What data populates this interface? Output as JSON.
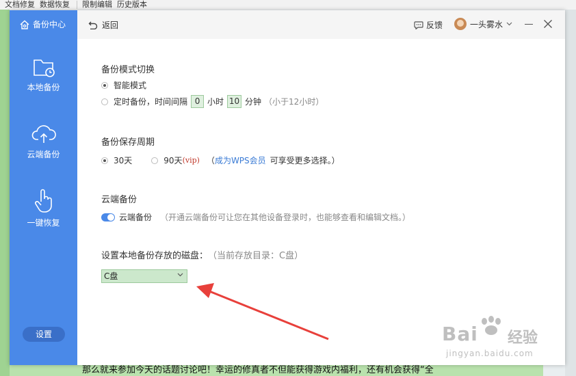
{
  "background": {
    "menu_items": [
      "文档修复",
      "数据恢复",
      "限制编辑",
      "历史版本"
    ],
    "doc_text": "那么就来参加今天的话题讨论吧！幸运的修真者不但能获得游戏内福利，还有机会获得“全"
  },
  "sidebar": {
    "title": "备份中心",
    "items": [
      {
        "label": "本地备份",
        "icon": "folder-clock-icon"
      },
      {
        "label": "云端备份",
        "icon": "cloud-upload-icon"
      },
      {
        "label": "一键恢复",
        "icon": "hand-pointer-icon"
      }
    ],
    "settings_label": "设置"
  },
  "topbar": {
    "back_label": "返回",
    "feedback_label": "反馈",
    "user_name": "一头雾水"
  },
  "backup_mode": {
    "title": "备份模式切换",
    "option_smart": "智能模式",
    "option_timed_prefix": "定时备份，时间间隔",
    "hours_value": "0",
    "hours_unit": "小时",
    "minutes_value": "10",
    "minutes_unit": "分钟",
    "timed_hint": "（小于12小时）",
    "selected": "smart"
  },
  "retention": {
    "title": "备份保存周期",
    "option_30": "30天",
    "option_90": "90天",
    "vip_tag": "(vip)",
    "note_open": "（",
    "member_link": "成为WPS会员",
    "note_rest": "可享受更多选择。）",
    "selected": "30"
  },
  "cloud": {
    "title": "云端备份",
    "toggle_label": "云端备份",
    "toggle_on": true,
    "hint": "（开通云端备份可让您在其他设备登录时，也能够查看和编辑文档。）"
  },
  "disk": {
    "title": "设置本地备份存放的磁盘：",
    "current_hint": "（当前存放目录：C盘）",
    "selected": "C盘"
  },
  "watermark": {
    "brand": "Bai",
    "brand_cn": "经验",
    "url": "jingyan.baidu.com"
  },
  "colors": {
    "sidebar": "#4a89e8",
    "accent_link": "#3a7bd5",
    "arrow": "#e8403b",
    "input_green": "#dff0df"
  }
}
